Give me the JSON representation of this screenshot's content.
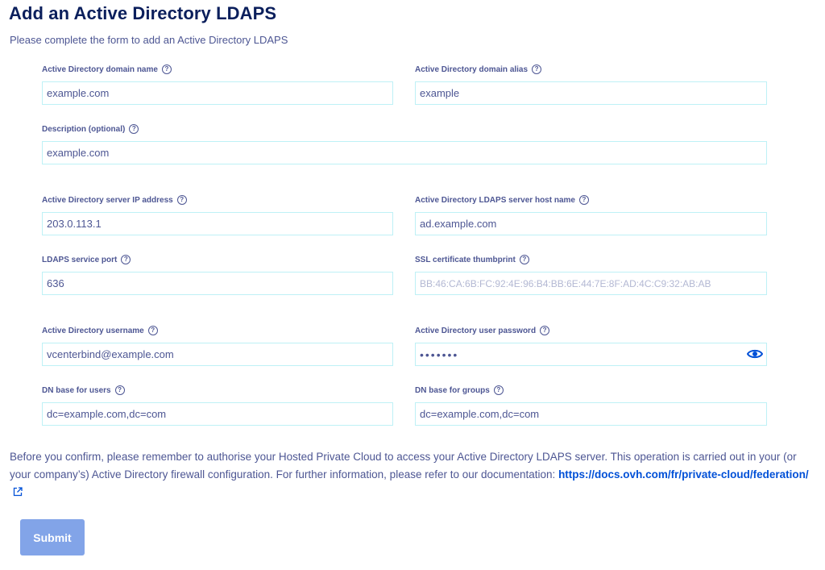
{
  "page": {
    "title": "Add an Active Directory LDAPS",
    "subtitle": "Please complete the form to add an Active Directory LDAPS"
  },
  "fields": {
    "domain_name": {
      "label": "Active Directory domain name",
      "value": "example.com",
      "placeholder": ""
    },
    "domain_alias": {
      "label": "Active Directory domain alias",
      "value": "example",
      "placeholder": ""
    },
    "description": {
      "label": "Description (optional)",
      "value": "example.com",
      "placeholder": ""
    },
    "server_ip": {
      "label": "Active Directory server IP address",
      "value": "203.0.113.1",
      "placeholder": ""
    },
    "server_host": {
      "label": "Active Directory LDAPS server host name",
      "value": "ad.example.com",
      "placeholder": ""
    },
    "port": {
      "label": "LDAPS service port",
      "value": "636",
      "placeholder": ""
    },
    "thumbprint": {
      "label": "SSL certificate thumbprint",
      "value": "",
      "placeholder": "BB:46:CA:6B:FC:92:4E:96:B4:BB:6E:44:7E:8F:AD:4C:C9:32:AB:AB"
    },
    "username": {
      "label": "Active Directory username",
      "value": "vcenterbind@example.com",
      "placeholder": ""
    },
    "password": {
      "label": "Active Directory user password",
      "value": "•••••••",
      "placeholder": ""
    },
    "dn_users": {
      "label": "DN base for users",
      "value": "dc=example.com,dc=com",
      "placeholder": ""
    },
    "dn_groups": {
      "label": "DN base for groups",
      "value": "dc=example.com,dc=com",
      "placeholder": ""
    }
  },
  "help_glyph": "?",
  "info": {
    "text": "Before you confirm, please remember to authorise your Hosted Private Cloud to access your Active Directory LDAPS server. This operation is carried out in your (or your company’s) Active Directory firewall configuration. For further information, please refer to our documentation: ",
    "link_text": "https://docs.ovh.com/fr/private-cloud/federation/"
  },
  "submit_label": "Submit",
  "icons": {
    "help": "help-circle-icon",
    "eye": "eye-icon",
    "external": "external-link-icon"
  },
  "colors": {
    "title": "#0b1f5c",
    "text": "#4d5693",
    "input_border": "#bef1f6",
    "link": "#0050d7",
    "submit_bg": "#82a4e8"
  }
}
